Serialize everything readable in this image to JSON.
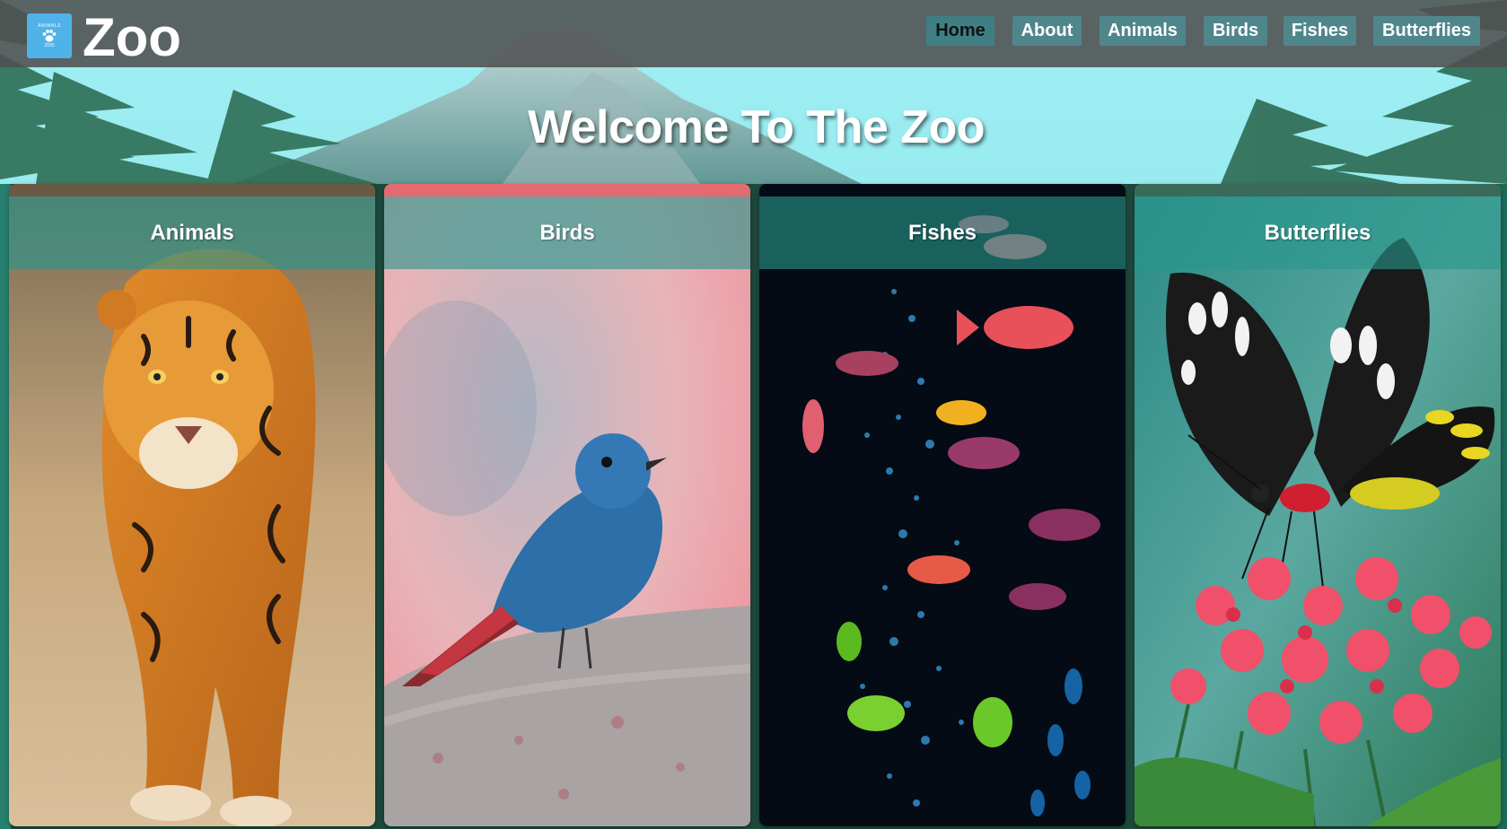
{
  "logo": {
    "badge_top": "ANIMALS",
    "badge_bottom": "ZOO",
    "icon": "paw-icon",
    "text": "Zoo"
  },
  "nav": {
    "items": [
      {
        "label": "Home",
        "active": true
      },
      {
        "label": "About",
        "active": false
      },
      {
        "label": "Animals",
        "active": false
      },
      {
        "label": "Birds",
        "active": false
      },
      {
        "label": "Fishes",
        "active": false
      },
      {
        "label": "Butterflies",
        "active": false
      }
    ]
  },
  "hero": {
    "title": "Welcome To The Zoo"
  },
  "cards": [
    {
      "title": "Animals",
      "image": "tiger-image"
    },
    {
      "title": "Birds",
      "image": "blue-bird-image"
    },
    {
      "title": "Fishes",
      "image": "aquarium-fish-image"
    },
    {
      "title": "Butterflies",
      "image": "butterfly-image"
    }
  ],
  "colors": {
    "navbar_bg": "#505050",
    "nav_button_bg": "#4f868b",
    "logo_bg": "#4fb2e8",
    "card_header_bg": "#2896a0",
    "sky": "#8ee7ee"
  }
}
